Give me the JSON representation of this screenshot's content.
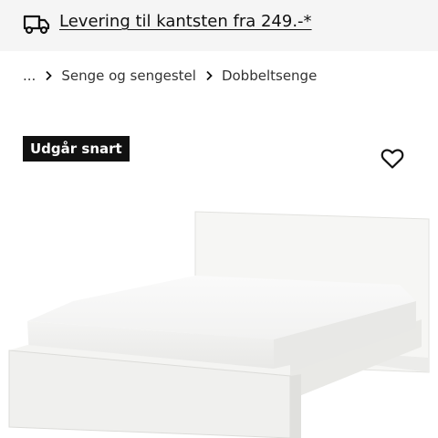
{
  "banner": {
    "text": "Levering til kantsten fra 249.-*",
    "icon": "delivery-truck-icon"
  },
  "breadcrumb": {
    "ellipsis": "...",
    "items": [
      "Senge og sengestel",
      "Dobbeltsenge"
    ],
    "separator_icon": "chevron-right-icon"
  },
  "product": {
    "badge": "Udgår snart",
    "favorite_icon": "heart-icon",
    "badge_color": "#111111"
  }
}
